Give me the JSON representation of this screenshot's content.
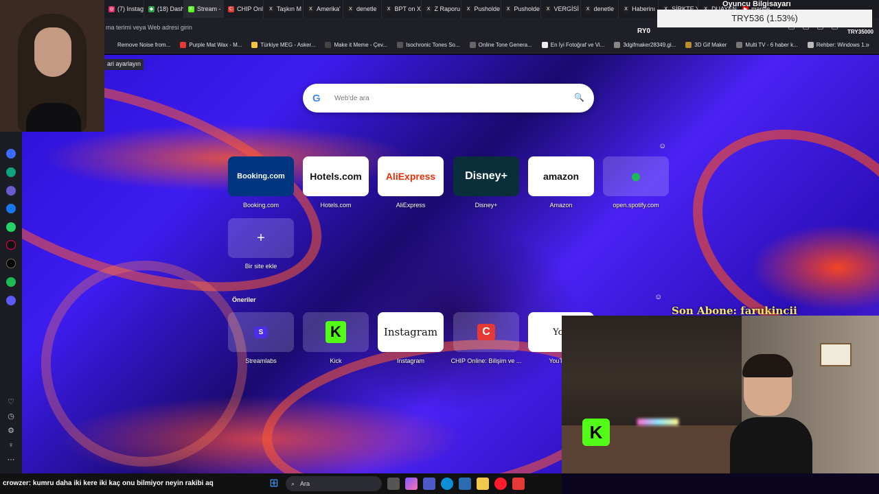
{
  "browser": {
    "tabs": [
      {
        "label": "(7) Instag",
        "color": "#e1306c",
        "glyph": "◎"
      },
      {
        "label": "(18) Dash",
        "color": "#2ea043",
        "glyph": "◆"
      },
      {
        "label": "Stream -",
        "color": "#53fc18",
        "glyph": "K"
      },
      {
        "label": "CHIP Onl",
        "color": "#e53935",
        "glyph": "C"
      },
      {
        "label": "Taşkın M",
        "color": "#222",
        "glyph": "X"
      },
      {
        "label": "Amerika'",
        "color": "#222",
        "glyph": "X"
      },
      {
        "label": "denetle",
        "color": "#222",
        "glyph": "X"
      },
      {
        "label": "BPT on X",
        "color": "#222",
        "glyph": "X"
      },
      {
        "label": "Z Raporu",
        "color": "#222",
        "glyph": "X"
      },
      {
        "label": "Pusholde",
        "color": "#222",
        "glyph": "X"
      },
      {
        "label": "Pusholde",
        "color": "#222",
        "glyph": "X"
      },
      {
        "label": "VERGİSİ",
        "color": "#222",
        "glyph": "X"
      },
      {
        "label": "denetle",
        "color": "#222",
        "glyph": "X"
      },
      {
        "label": "Haberinı",
        "color": "#222",
        "glyph": "X"
      },
      {
        "label": "ŞİRKTE Y",
        "color": "#222",
        "glyph": "X"
      },
      {
        "label": "DUAYEN",
        "color": "#222",
        "glyph": "X"
      },
      {
        "label": "manife",
        "color": "#ff0000",
        "glyph": "▶"
      }
    ],
    "address_placeholder": "ma terimi veya Web adresi girin",
    "bookmarks": [
      {
        "label": "Remove Noise from...",
        "color": "#1e1e28"
      },
      {
        "label": "Purple Mat Wax - M...",
        "color": "#e53935"
      },
      {
        "label": "Türkiye MEG - Asker...",
        "color": "#f5c542"
      },
      {
        "label": "Make it Meme - Çev...",
        "color": "#444"
      },
      {
        "label": "Isochronic Tones So...",
        "color": "#555"
      },
      {
        "label": "Online Tone Genera...",
        "color": "#666"
      },
      {
        "label": "En İyi Fotoğraf ve Vi...",
        "color": "#eee"
      },
      {
        "label": "3dgifmaker28349.gi...",
        "color": "#888"
      },
      {
        "label": "3D Gif Maker",
        "color": "#b78c2d"
      },
      {
        "label": "Multi TV - 6 haber k...",
        "color": "#777"
      },
      {
        "label": "Rehber: Windows 1...",
        "color": "#bbb"
      }
    ],
    "bookmarks_more": "»",
    "tip": "ari ayarlayın"
  },
  "search": {
    "google_glyph": "G",
    "placeholder": "Web'de ara",
    "search_glyph": "🔍"
  },
  "speed_dial": [
    {
      "label": "Booking.com",
      "tile_text": "Booking.com",
      "style": "booking"
    },
    {
      "label": "Hotels.com",
      "tile_text": "Hotels.com",
      "style": "white"
    },
    {
      "label": "AliExpress",
      "tile_text": "AliExpress",
      "style": "ali"
    },
    {
      "label": "Disney+",
      "tile_text": "Disney+",
      "style": "disney"
    },
    {
      "label": "Amazon",
      "tile_text": "amazon",
      "style": "white"
    },
    {
      "label": "open.spotify.com",
      "tile_text": "●",
      "style": "ghost"
    }
  ],
  "add_site": {
    "glyph": "+",
    "label": "Bir site ekle"
  },
  "suggestions": {
    "title": "Öneriler",
    "items": [
      {
        "label": "Streamlabs",
        "tile_text": "S"
      },
      {
        "label": "Kick",
        "tile_text": "K"
      },
      {
        "label": "Instagram",
        "tile_text": "Instagram"
      },
      {
        "label": "CHIP Online: Bilişim ve ...",
        "tile_text": "C"
      },
      {
        "label": "YouTube",
        "tile_text": "You"
      }
    ]
  },
  "stream": {
    "donation_title": "Oyuncu Bilgisayarı",
    "donation_value": "TRY536 (1.53%)",
    "goal_left": "RY0",
    "goal_right": "TRY35000",
    "last_sub": "Son Abone: farukincii",
    "chat_user": "crowzer",
    "chat_message": ": kumru daha iki kere iki kaç onu bilmiyor neyin rakibi aq"
  },
  "taskbar": {
    "search_label": "Ara"
  },
  "colors": {
    "accent_spotify": "#1db954",
    "kick_green": "#53fc18",
    "sub_label": "#f4e56a"
  }
}
